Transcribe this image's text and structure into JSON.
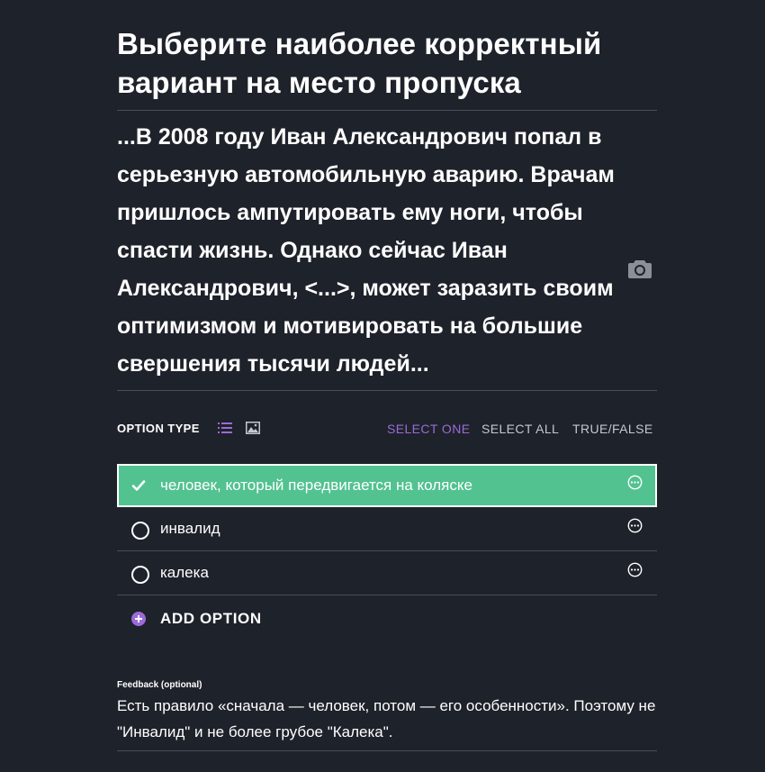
{
  "title": "Выберите наиболее корректный вариант на место пропуска",
  "question": "...В 2008 году Иван Александрович попал в серьезную автомобильную аварию. Врачам пришлось ампутировать ему ноги, чтобы спасти жизнь. Однако сейчас Иван Александрович, <...>, может заразить своим оптимизмом и мотивировать на большие свершения тысячи людей...",
  "option_type": {
    "label": "OPTION TYPE",
    "icons": [
      "list-icon",
      "image-icon"
    ],
    "modes": [
      "SELECT ONE",
      "SELECT ALL",
      "TRUE/FALSE"
    ],
    "active_mode": "SELECT ONE"
  },
  "options": [
    {
      "label": "человек, который передвигается на коляске",
      "selected": true
    },
    {
      "label": "инвалид",
      "selected": false
    },
    {
      "label": "калека",
      "selected": false
    }
  ],
  "add_option_label": "ADD OPTION",
  "feedback": {
    "label": "Feedback (optional)",
    "text": "Есть правило «сначала — человек, потом — его особенности». Поэтому не \"Инвалид\" и не более грубое \"Калека\"."
  },
  "colors": {
    "background": "#1e222a",
    "selected_option": "#52c290",
    "accent": "#9b6bd9",
    "divider": "#4a4f58"
  }
}
